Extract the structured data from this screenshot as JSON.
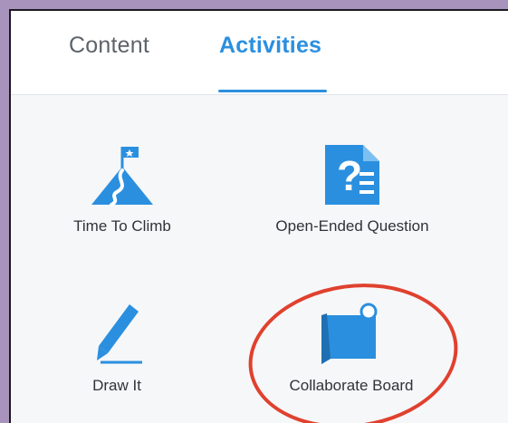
{
  "tabs": [
    {
      "label": "Content",
      "active": false
    },
    {
      "label": "Activities",
      "active": true
    }
  ],
  "activities": [
    {
      "label": "Time To Climb",
      "icon": "mountain-flag-icon"
    },
    {
      "label": "Open-Ended Question",
      "icon": "question-document-icon"
    },
    {
      "label": "Draw It",
      "icon": "pencil-icon"
    },
    {
      "label": "Collaborate Board",
      "icon": "pinned-board-icon"
    }
  ],
  "colors": {
    "accent": "#2b8fdf",
    "highlight": "#e0412e",
    "frame": "#a893bd"
  }
}
